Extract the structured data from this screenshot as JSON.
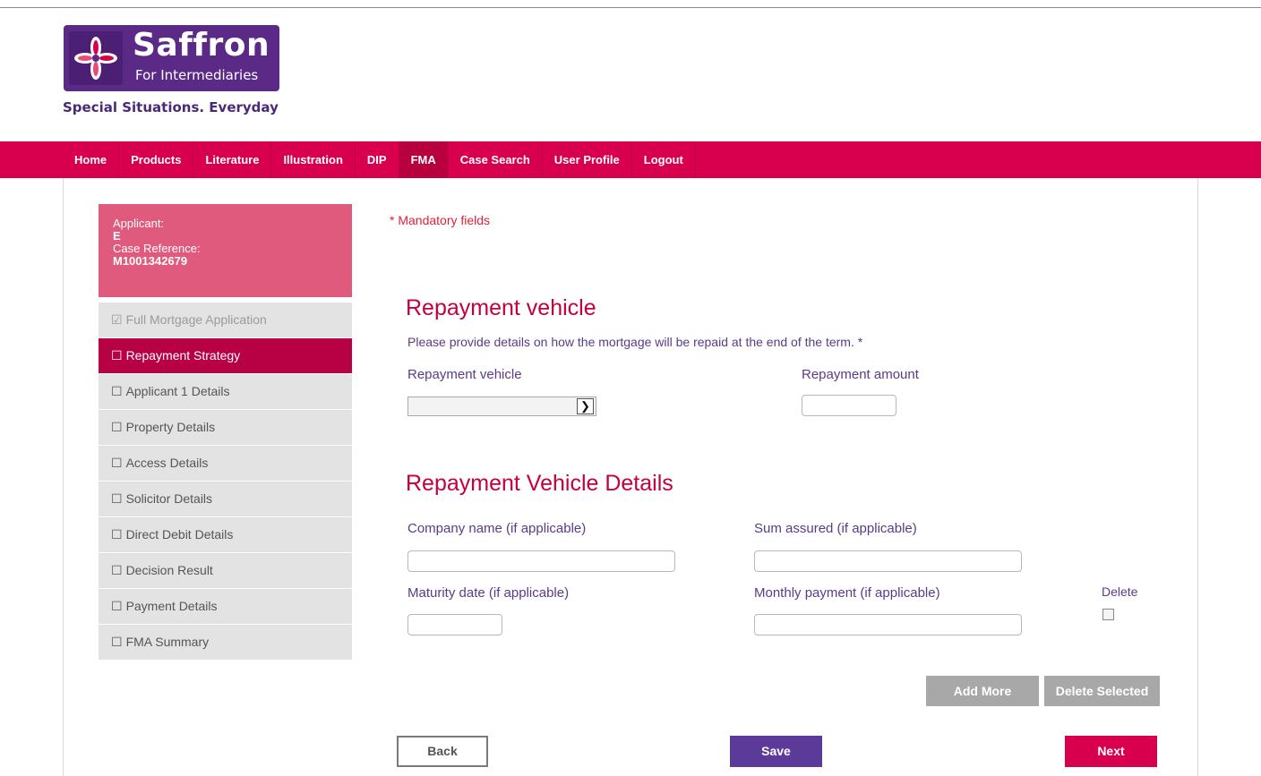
{
  "brand": {
    "name": "Saffron",
    "sub": "For Intermediaries",
    "tagline": "Special Situations. Everyday"
  },
  "nav": {
    "items": [
      "Home",
      "Products",
      "Literature",
      "Illustration",
      "DIP",
      "FMA",
      "Case Search",
      "User Profile",
      "Logout"
    ],
    "active": "FMA"
  },
  "applicant": {
    "applicant_label": "Applicant:",
    "applicant_value": "E",
    "case_label": "Case Reference:",
    "case_value": "M1001342679"
  },
  "sidebar": {
    "items": [
      {
        "label": "Full Mortgage Application",
        "state": "done"
      },
      {
        "label": "Repayment Strategy",
        "state": "active"
      },
      {
        "label": "Applicant 1 Details",
        "state": "todo"
      },
      {
        "label": "Property Details",
        "state": "todo"
      },
      {
        "label": "Access Details",
        "state": "todo"
      },
      {
        "label": "Solicitor Details",
        "state": "todo"
      },
      {
        "label": "Direct Debit Details",
        "state": "todo"
      },
      {
        "label": "Decision Result",
        "state": "todo"
      },
      {
        "label": "Payment Details",
        "state": "todo"
      },
      {
        "label": "FMA Summary",
        "state": "todo"
      }
    ]
  },
  "form": {
    "mandatory_note": "* Mandatory fields",
    "section1_title": "Repayment vehicle",
    "section1_desc": "Please provide details on how the mortgage will be repaid at the end of the term. *",
    "repayment_vehicle_label": "Repayment vehicle",
    "repayment_vehicle_value": "",
    "repayment_amount_label": "Repayment amount",
    "repayment_amount_value": "",
    "section2_title": "Repayment Vehicle Details",
    "company_label": "Company name (if applicable)",
    "company_value": "",
    "sum_assured_label": "Sum assured (if applicable)",
    "sum_assured_value": "",
    "maturity_label": "Maturity date (if applicable)",
    "maturity_value": "",
    "monthly_label": "Monthly payment (if applicable)",
    "monthly_value": "",
    "delete_label": "Delete",
    "delete_checked": false
  },
  "buttons": {
    "add_more": "Add More",
    "delete_selected": "Delete Selected",
    "back": "Back",
    "save": "Save",
    "next": "Next"
  },
  "colors": {
    "brand_purple": "#5b2a86",
    "nav_pink": "#d8004e",
    "active_sidebar": "#b80045",
    "applicant_box": "#e05a7e",
    "heading": "#c4003e",
    "label_purple": "#5b3a8a"
  }
}
